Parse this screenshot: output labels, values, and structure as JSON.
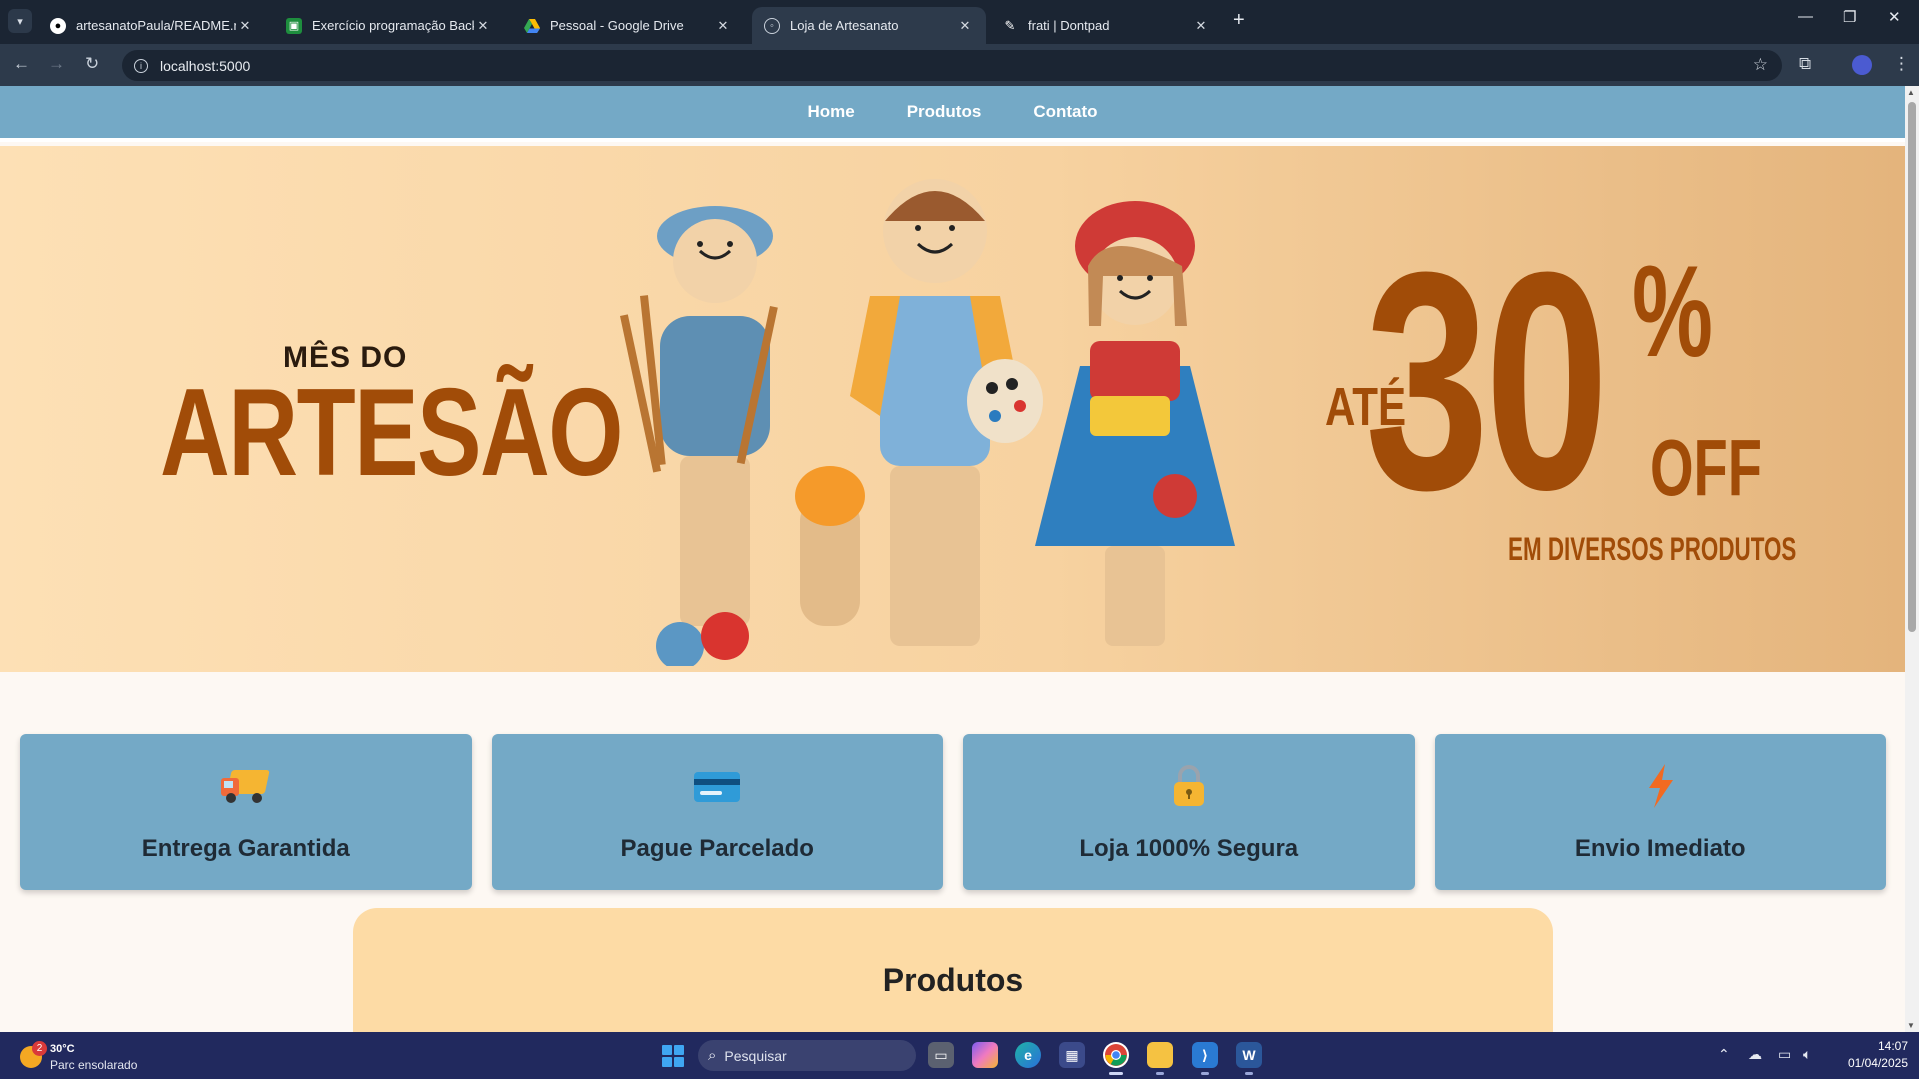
{
  "browser": {
    "tabs": [
      {
        "title": "artesanatoPaula/README.md at",
        "icon": "github-icon"
      },
      {
        "title": "Exercício programação Back En",
        "icon": "classroom-icon"
      },
      {
        "title": "Pessoal - Google Drive",
        "icon": "google-drive-icon"
      },
      {
        "title": "Loja de Artesanato",
        "icon": "globe-icon",
        "active": true
      },
      {
        "title": "frati | Dontpad",
        "icon": "dontpad-icon"
      }
    ],
    "url": "localhost:5000"
  },
  "site": {
    "nav": [
      "Home",
      "Produtos",
      "Contato"
    ],
    "banner": {
      "kicker": "MÊS DO",
      "headline": "ARTESÃO",
      "prefix": "ATÉ",
      "discount": "30",
      "percent": "%",
      "off": "OFF",
      "sub": "EM DIVERSOS PRODUTOS"
    },
    "features": [
      {
        "label": "Entrega Garantida",
        "icon": "delivery-truck-icon"
      },
      {
        "label": "Pague Parcelado",
        "icon": "credit-card-icon"
      },
      {
        "label": "Loja 1000% Segura",
        "icon": "padlock-icon"
      },
      {
        "label": "Envio Imediato",
        "icon": "lightning-icon"
      }
    ],
    "products_title": "Produtos"
  },
  "taskbar": {
    "weather": {
      "temp": "30°C",
      "desc": "Parc ensolarado",
      "badge": "2"
    },
    "search_placeholder": "Pesquisar",
    "time": "14:07",
    "date": "01/04/2025"
  },
  "colors": {
    "nav_bg": "#74a9c6",
    "feature_bg": "#74a9c6",
    "accent_orange": "#a14c08",
    "products_bg": "#fddba5",
    "page_bg": "#fdf8f3"
  }
}
